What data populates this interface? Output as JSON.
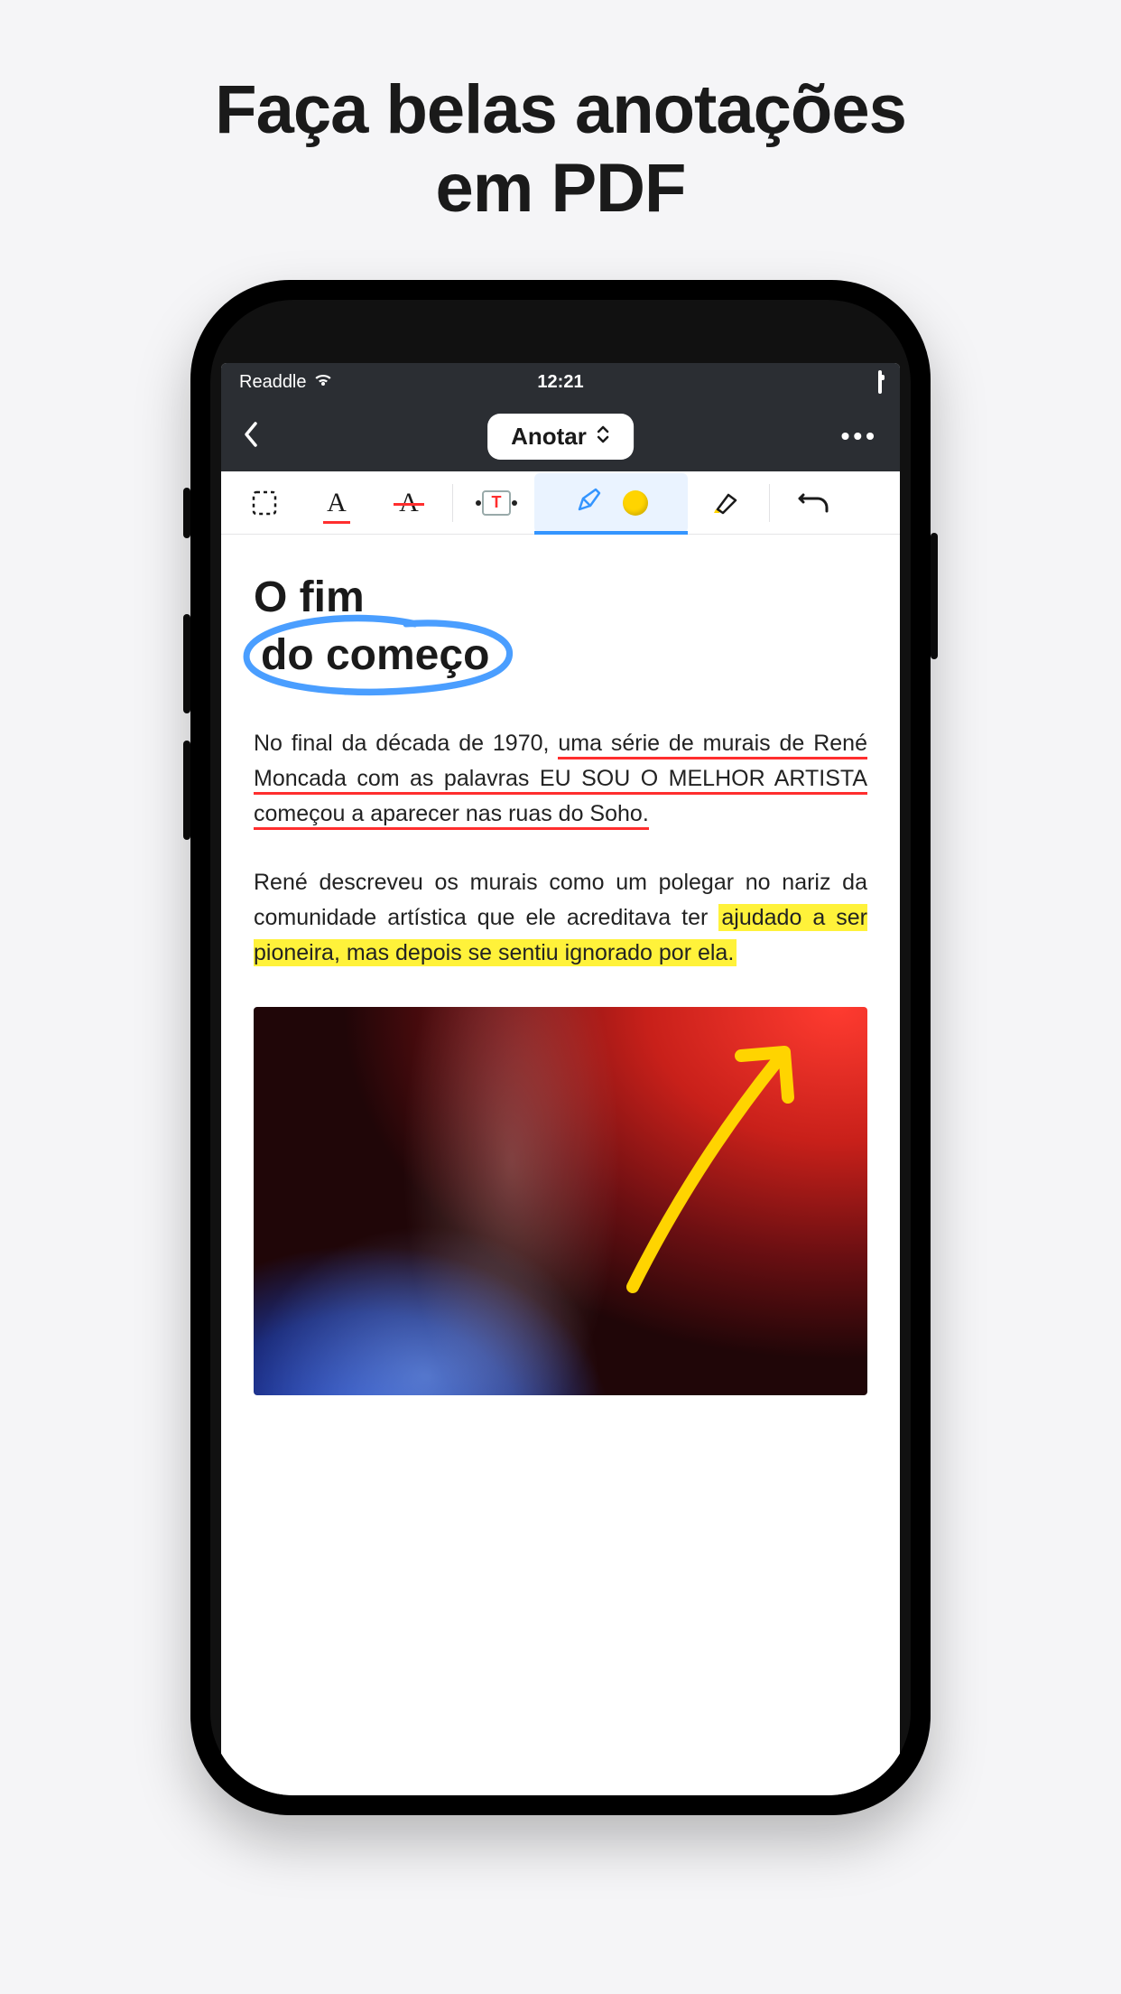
{
  "promo": {
    "line1": "Faça belas anotações",
    "line2": "em PDF"
  },
  "status": {
    "carrier": "Readdle",
    "time": "12:21"
  },
  "nav": {
    "mode_label": "Anotar"
  },
  "tools": {
    "select": "select",
    "underline": "A",
    "strike": "A",
    "textbox": "T",
    "pen_color": "#ffd400"
  },
  "document": {
    "title_line1": "O fim",
    "title_line2": "do começo",
    "p1_plain": "No final da década de 1970, ",
    "p1_underlined": "uma série de murais de René Moncada com as palavras EU SOU O MELHOR ARTISTA começou a aparecer nas ruas do Soho.",
    "p2_plain": "René descreveu os murais como um polegar no nariz da comunidade artística que ele acreditava ter ",
    "p2_highlighted": "ajudado a ser pioneira, mas depois se sentiu ignorado por ela."
  }
}
